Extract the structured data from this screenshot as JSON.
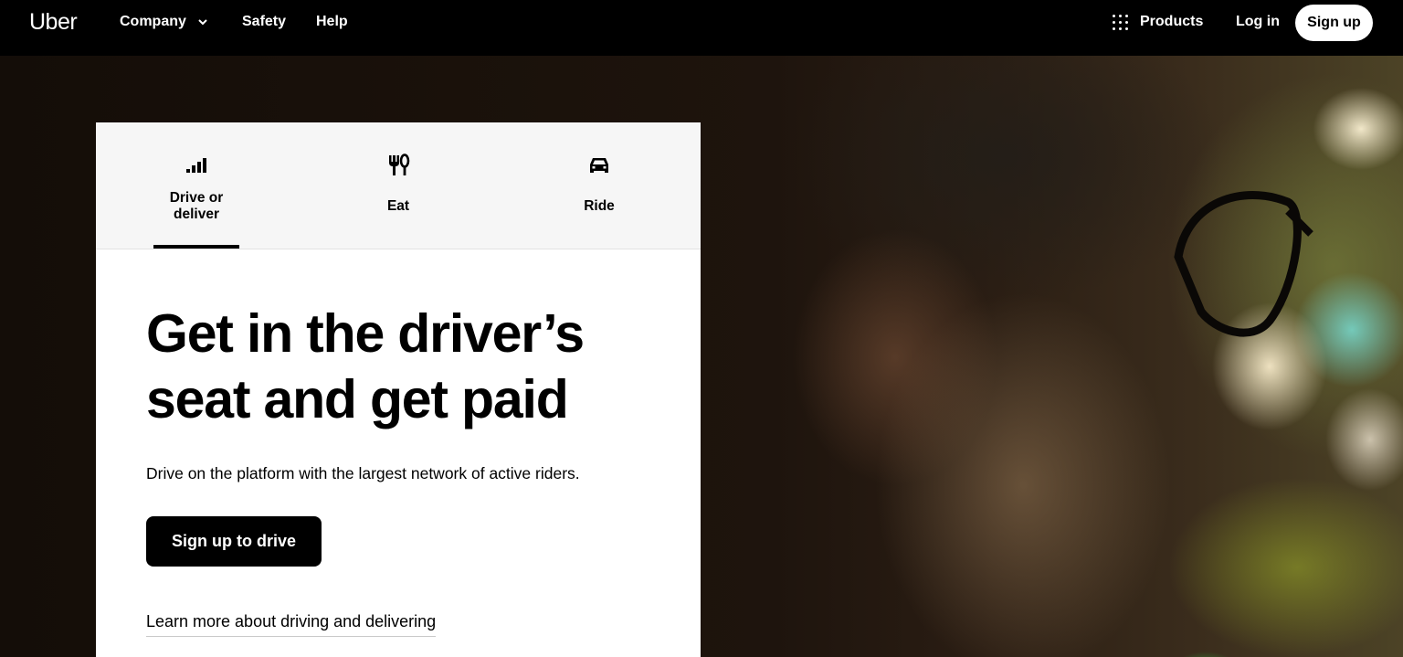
{
  "nav": {
    "logo": "Uber",
    "company": "Company",
    "safety": "Safety",
    "help": "Help",
    "products": "Products",
    "login": "Log in",
    "signup": "Sign up"
  },
  "tabs": [
    {
      "label": "Drive or deliver",
      "icon": "bar-chart-icon",
      "selected": true
    },
    {
      "label": "Eat",
      "icon": "fork-knife-icon",
      "selected": false
    },
    {
      "label": "Ride",
      "icon": "car-icon",
      "selected": false
    }
  ],
  "hero": {
    "headline": "Get in the driver’s seat and get paid",
    "subtext": "Drive on the platform with the largest network of active riders.",
    "cta": "Sign up to drive",
    "learn_more": "Learn more about driving and delivering"
  },
  "colors": {
    "nav_bg": "#000000",
    "card_bg": "#ffffff",
    "tabs_bg": "#f6f6f6",
    "cta_bg": "#000000"
  }
}
